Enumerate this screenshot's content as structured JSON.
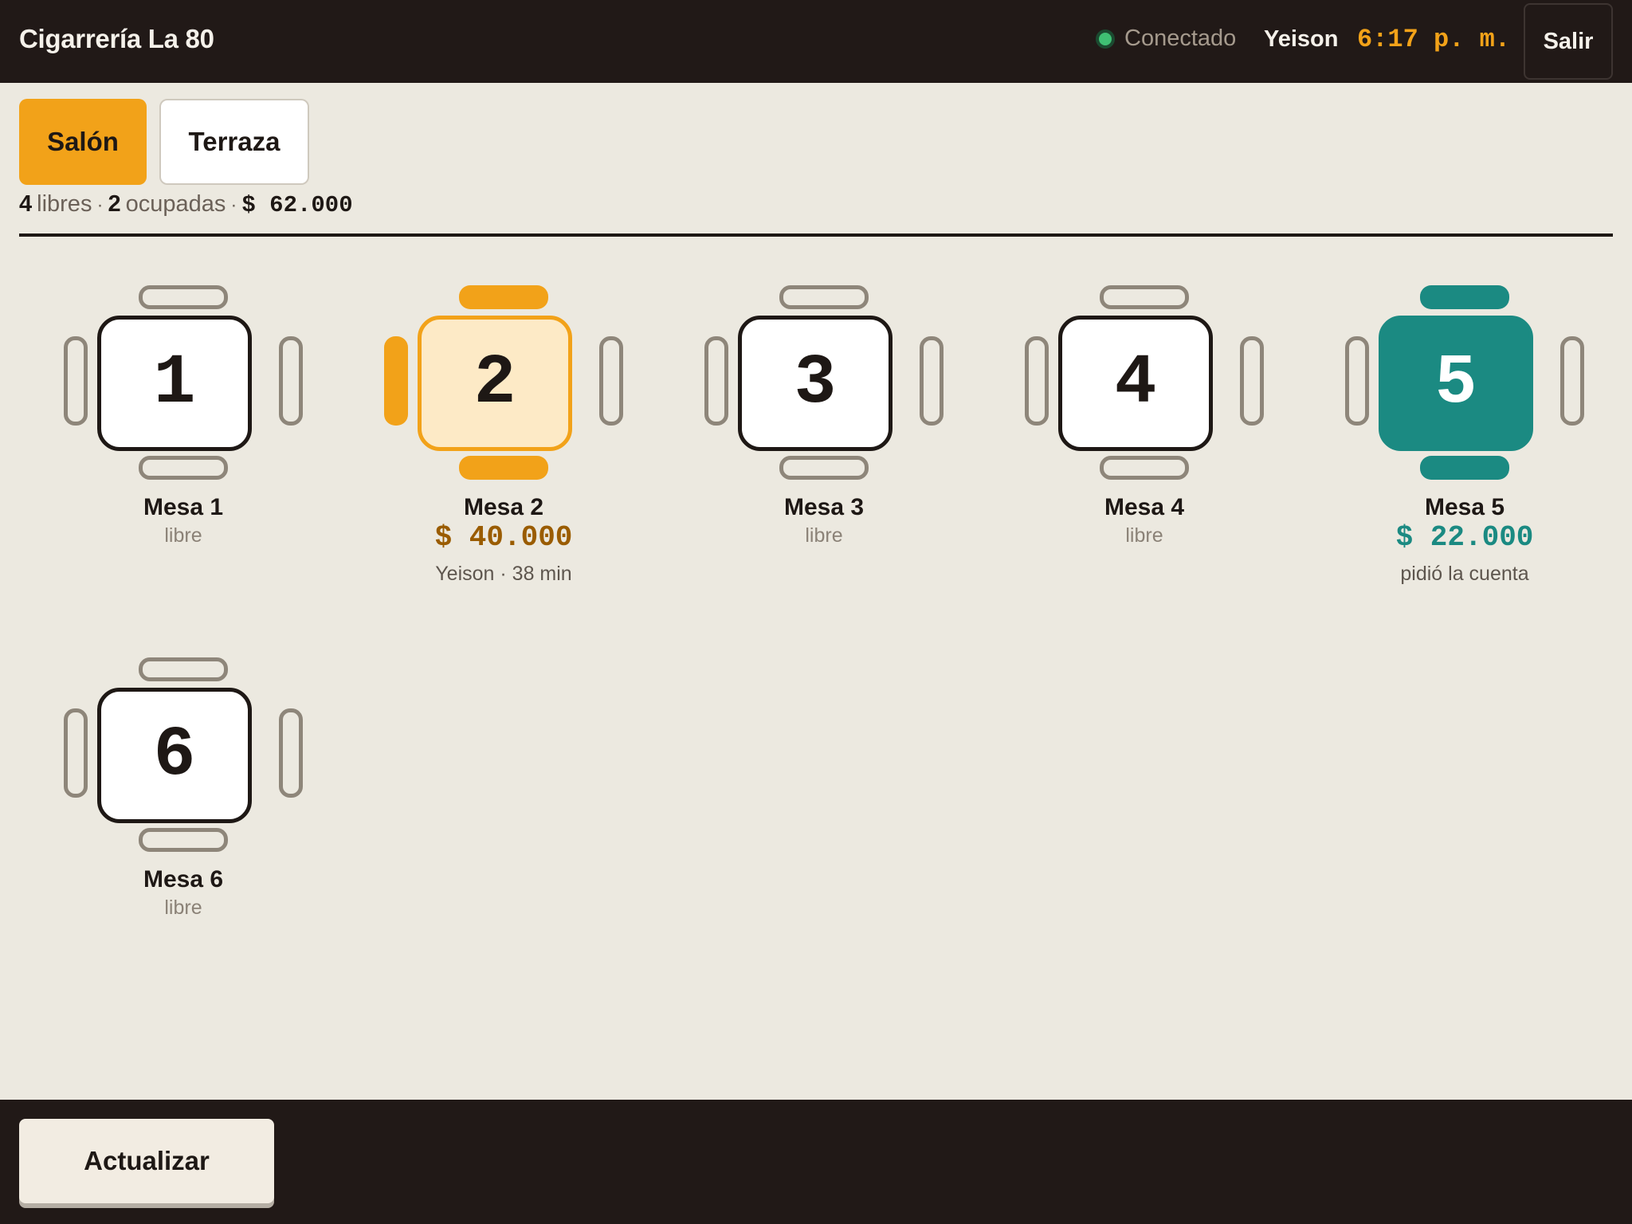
{
  "header": {
    "app_title": "Cigarrería La 80",
    "status": "Conectado",
    "user": "Yeison",
    "time": "6:17 p. m.",
    "logout_label": "Salir",
    "colors": {
      "accent": "#F2A219",
      "online": "#3FBF73",
      "bar": "#211917"
    }
  },
  "tabs": [
    {
      "label": "Salón",
      "active": true
    },
    {
      "label": "Terraza",
      "active": false
    }
  ],
  "summary": {
    "free_count": "4",
    "free_label": "libres",
    "occupied_count": "2",
    "occupied_label": "ocupadas",
    "separator": "·",
    "total": "$ 62.000"
  },
  "tables": [
    {
      "number": "1",
      "name": "Mesa 1",
      "status": "libre"
    },
    {
      "number": "2",
      "name": "Mesa 2",
      "amount": "$ 40.000",
      "detail": "Yeison · 38 min",
      "state_color": "#F2A219"
    },
    {
      "number": "3",
      "name": "Mesa 3",
      "status": "libre"
    },
    {
      "number": "4",
      "name": "Mesa 4",
      "status": "libre"
    },
    {
      "number": "5",
      "name": "Mesa 5",
      "amount": "$ 22.000",
      "detail": "pidió la cuenta",
      "state_color": "#1B8A82"
    },
    {
      "number": "6",
      "name": "Mesa 6",
      "status": "libre"
    }
  ],
  "footer": {
    "refresh_label": "Actualizar"
  }
}
